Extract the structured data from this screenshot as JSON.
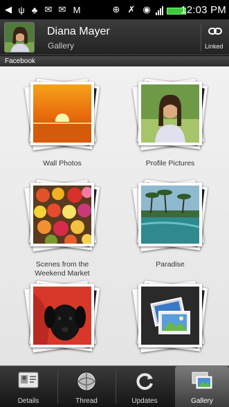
{
  "status_bar": {
    "time": "12:03 PM",
    "icons": [
      "app-icon",
      "usb-icon",
      "debug-icon",
      "mail-icon",
      "mail-icon",
      "gmail-icon",
      "gps-icon",
      "bluetooth-icon",
      "wifi-icon",
      "signal-icon",
      "battery-icon"
    ]
  },
  "header": {
    "name": "Diana Mayer",
    "subtitle": "Gallery",
    "link_label": "Linked"
  },
  "section_label": "Facebook",
  "albums": [
    {
      "label": "Wall Photos"
    },
    {
      "label": "Profile Pictures"
    },
    {
      "label": "Scenes from the\nWeekend Market"
    },
    {
      "label": "Paradise"
    },
    {
      "label": ""
    },
    {
      "label": ""
    }
  ],
  "tabs": [
    {
      "label": "Details",
      "active": false
    },
    {
      "label": "Thread",
      "active": false
    },
    {
      "label": "Updates",
      "active": false
    },
    {
      "label": "Gallery",
      "active": true
    }
  ],
  "colors": {
    "battery": "#3cc83c",
    "grid_bg": "#eaeaea",
    "header_bg": "#2e2e2e"
  }
}
